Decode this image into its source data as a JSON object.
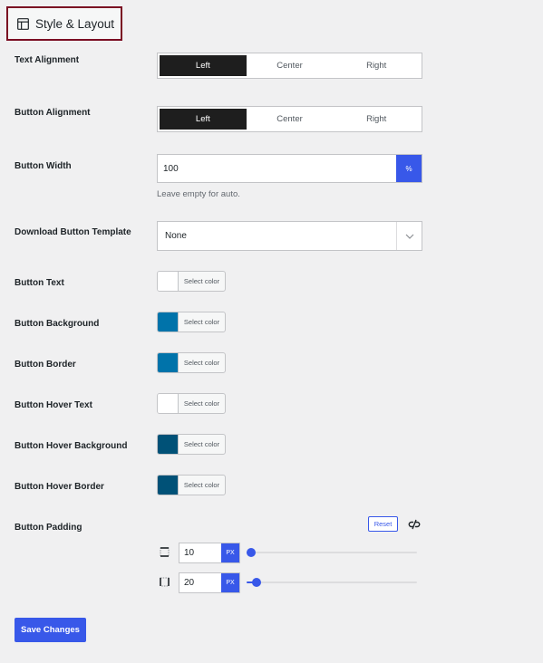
{
  "section": {
    "title": "Style & Layout",
    "icon": "layout-icon"
  },
  "text_alignment": {
    "label": "Text Alignment",
    "options": [
      "Left",
      "Center",
      "Right"
    ],
    "selected": "Left"
  },
  "button_alignment": {
    "label": "Button Alignment",
    "options": [
      "Left",
      "Center",
      "Right"
    ],
    "selected": "Left"
  },
  "button_width": {
    "label": "Button Width",
    "value": "100",
    "unit": "%",
    "help": "Leave empty for auto."
  },
  "download_template": {
    "label": "Download Button Template",
    "value": "None",
    "icon": "chevron-down-icon"
  },
  "colors": [
    {
      "label": "Button Text",
      "button_text": "Select color",
      "swatch": "#ffffff"
    },
    {
      "label": "Button Background",
      "button_text": "Select color",
      "swatch": "#0073aa"
    },
    {
      "label": "Button Border",
      "button_text": "Select color",
      "swatch": "#0073aa"
    },
    {
      "label": "Button Hover Text",
      "button_text": "Select color",
      "swatch": "#ffffff"
    },
    {
      "label": "Button Hover Background",
      "button_text": "Select color",
      "swatch": "#005177"
    },
    {
      "label": "Button Hover Border",
      "button_text": "Select color",
      "swatch": "#005177"
    }
  ],
  "button_padding": {
    "label": "Button Padding",
    "reset_label": "Reset",
    "link_icon": "unlink-icon",
    "vertical": {
      "value": "10",
      "unit": "PX",
      "level": 0.02,
      "icon": "padding-vertical-icon"
    },
    "horizontal": {
      "value": "20",
      "unit": "PX",
      "level": 0.06,
      "icon": "padding-horizontal-icon"
    }
  },
  "save_label": "Save Changes",
  "accent_color": "#3858e9"
}
